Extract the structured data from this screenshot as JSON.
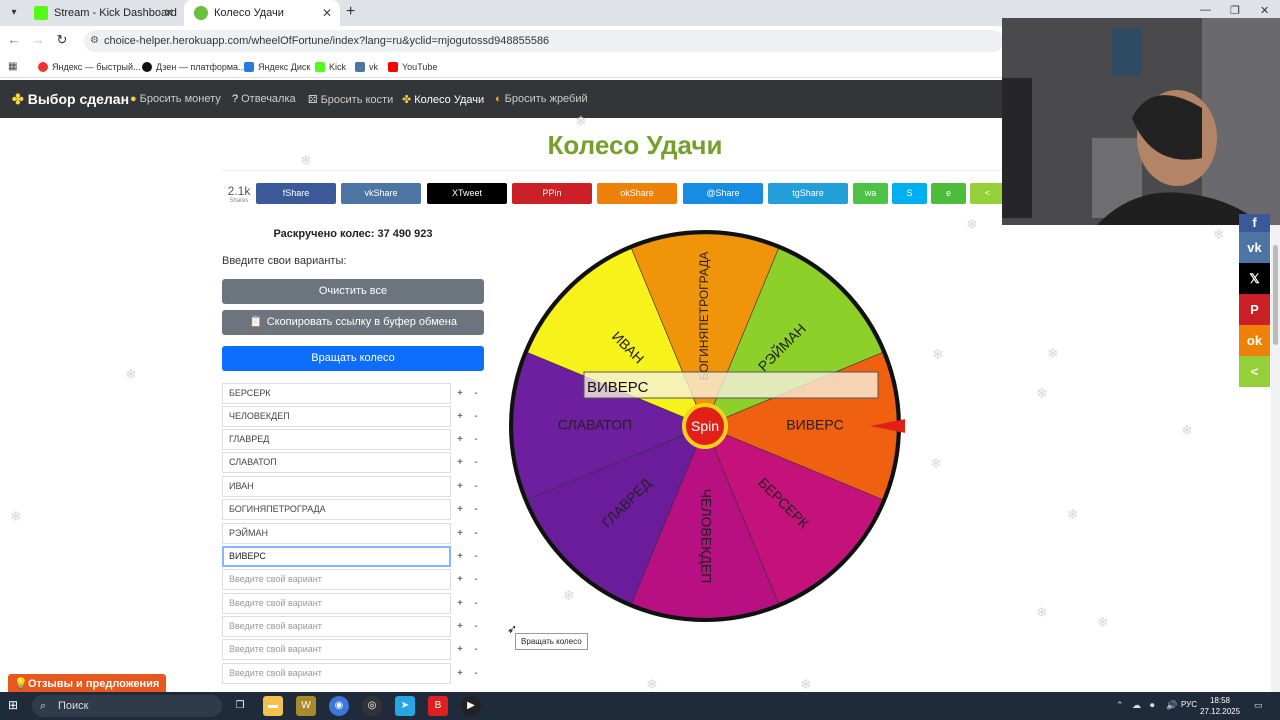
{
  "browser": {
    "tabs": [
      {
        "title": "Stream - Kick Dashboard",
        "active": false
      },
      {
        "title": "Колесо Удачи",
        "active": true
      }
    ],
    "url": "choice-helper.herokuapp.com/wheelOfFortune/index?lang=ru&yclid=mjogutossd948855586",
    "bookmarks": [
      "Яндекс — быстрый...",
      "Дзен — платформа...",
      "Яндекс Диск",
      "Kick",
      "vk",
      "YouTube"
    ]
  },
  "sitenav": {
    "brand": "Выбор сделан",
    "links": [
      "Бросить монету",
      "Отвечалка",
      "Бросить кости",
      "Колесо Удачи",
      "Бросить жребий"
    ]
  },
  "page": {
    "title": "Колесо Удачи",
    "share_count": "2.1k",
    "share_count_label": "Shares",
    "share_buttons": [
      {
        "label": "Share",
        "icon": "f",
        "color": "#3b5998"
      },
      {
        "label": "Share",
        "icon": "vk",
        "color": "#4c75a3"
      },
      {
        "label": "Tweet",
        "icon": "X",
        "color": "#000000"
      },
      {
        "label": "Pin",
        "icon": "P",
        "color": "#cb2027"
      },
      {
        "label": "Share",
        "icon": "ok",
        "color": "#ee8208"
      },
      {
        "label": "Share",
        "icon": "@",
        "color": "#168de2"
      },
      {
        "label": "Share",
        "icon": "tg",
        "color": "#229ed9"
      },
      {
        "label": "",
        "icon": "wa",
        "color": "#4dc247"
      },
      {
        "label": "",
        "icon": "S",
        "color": "#00aff0"
      },
      {
        "label": "",
        "icon": "e",
        "color": "#4cbc3a"
      },
      {
        "label": "",
        "icon": "<",
        "color": "#95d03a"
      }
    ],
    "spun_text": "Раскручено колес: 37 490 923",
    "prompt": "Введите свои варианты:",
    "clear_btn": "Очистить все",
    "copy_btn": "Скопировать ссылку в буфер обмена",
    "spin_btn": "Вращать колесо",
    "options": [
      "БЕРСЕРК",
      "ЧЕЛОВЕКДЕП",
      "ГЛАВРЕД",
      "СЛАВАТОП",
      "ИВАН",
      "БОГИНЯПЕТРОГРАДА",
      "РЭЙМАН",
      "ВИВЕРС"
    ],
    "placeholder": "Введите свой вариант",
    "tooltip": "Вращать колесо",
    "feedback": "Отзывы и предложения"
  },
  "wheel": {
    "center_label": "Spin",
    "winner": "ВИВЕРС",
    "segments": [
      {
        "label": "ВИВЕРС",
        "color": "#ef6010"
      },
      {
        "label": "БЕРСЕРК",
        "color": "#c4127a"
      },
      {
        "label": "ЧЕЛОВЕКДЕП",
        "color": "#b80f82"
      },
      {
        "label": "ГЛАВРЕД",
        "color": "#6a1c9a"
      },
      {
        "label": "СЛАВАТОП",
        "color": "#6e1fa0"
      },
      {
        "label": "ИВАН",
        "color": "#f6f21a"
      },
      {
        "label": "БОГИНЯПЕТРОГРАДА",
        "color": "#f0940a"
      },
      {
        "label": "РЭЙМАН",
        "color": "#8ed02a"
      }
    ]
  },
  "taskbar": {
    "search": "Поиск",
    "lang": "РУС",
    "time": "18:58",
    "date": "27.12.2025"
  }
}
